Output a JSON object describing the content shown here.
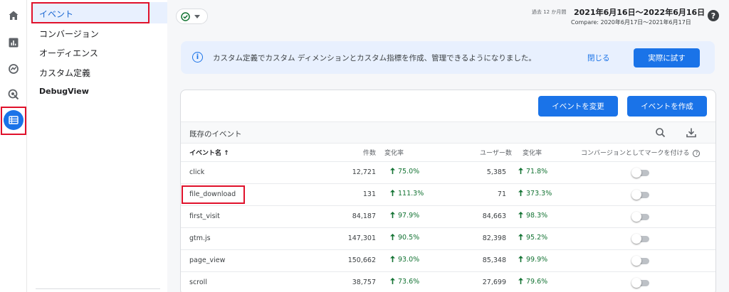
{
  "colors": {
    "accent": "#1a73e8",
    "highlight": "#e0112b",
    "positive": "#137333"
  },
  "rail": {
    "icons": [
      "home-icon",
      "reports-icon",
      "explore-icon",
      "advertising-icon",
      "configure-icon"
    ]
  },
  "subnav": {
    "items": [
      "イベント",
      "コンバージョン",
      "オーディエンス",
      "カスタム定義",
      "DebugView"
    ]
  },
  "header": {
    "date_prefix": "過去 12 か月間",
    "date_range": "2021年6月16日～2022年6月16日",
    "compare": "Compare: 2020年6月17日～2021年6月17日",
    "help": "?"
  },
  "banner": {
    "text": "カスタム定義でカスタム ディメンションとカスタム指標を作成、管理できるようになりました。",
    "close_label": "閉じる",
    "try_label": "実際に試す"
  },
  "card": {
    "modify_label": "イベントを変更",
    "create_label": "イベントを作成",
    "section_title": "既存のイベント"
  },
  "table": {
    "headers": {
      "name": "イベント名",
      "sort": "↑",
      "count": "件数",
      "count_change": "変化率",
      "users": "ユーザー数",
      "users_change": "変化率",
      "conversion": "コンバージョンとしてマークを付ける"
    },
    "rows": [
      {
        "name": "click",
        "count": "12,721",
        "count_change": "75.0%",
        "users": "5,385",
        "users_change": "71.8%",
        "conversion": false
      },
      {
        "name": "file_download",
        "count": "131",
        "count_change": "111.3%",
        "users": "71",
        "users_change": "373.3%",
        "conversion": false
      },
      {
        "name": "first_visit",
        "count": "84,187",
        "count_change": "97.9%",
        "users": "84,663",
        "users_change": "98.3%",
        "conversion": false
      },
      {
        "name": "gtm.js",
        "count": "147,301",
        "count_change": "90.5%",
        "users": "82,398",
        "users_change": "95.2%",
        "conversion": false
      },
      {
        "name": "page_view",
        "count": "150,662",
        "count_change": "93.0%",
        "users": "85,348",
        "users_change": "99.9%",
        "conversion": false
      },
      {
        "name": "scroll",
        "count": "38,757",
        "count_change": "73.6%",
        "users": "27,699",
        "users_change": "79.6%",
        "conversion": false
      }
    ]
  }
}
